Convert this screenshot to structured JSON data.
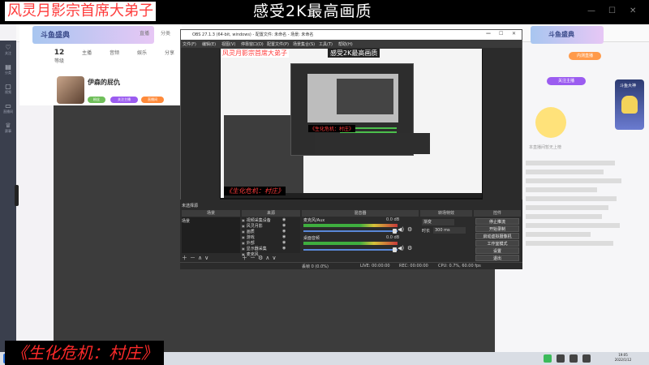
{
  "overlay": {
    "stream_title": "风灵月影宗首席大弟子",
    "quality_text": "感受2K最高画质",
    "subtitle": "《生化危机：村庄》"
  },
  "browser": {
    "left_banner": "斗鱼盛典",
    "nav_links": [
      "直播",
      "分类",
      "视频"
    ],
    "stats": [
      {
        "value": "12",
        "label": "等级"
      },
      {
        "value": "",
        "label": "主播"
      },
      {
        "value": "",
        "label": "音频"
      },
      {
        "value": "",
        "label": "娱乐"
      },
      {
        "value": "",
        "label": "分享"
      }
    ],
    "streamer_name": "伊森的屁仇",
    "pills": [
      "粉丝",
      "关注主播",
      "直播间"
    ],
    "right_banner": "斗鱼盛典",
    "current_button": "内测直播",
    "right_tag": "关注主播",
    "badge_label": "斗鱼大神",
    "mascot_caption": "本直播间暂无上榜"
  },
  "sidebar": {
    "items": [
      {
        "icon": "heart-icon",
        "glyph": "♡",
        "label": "关注"
      },
      {
        "icon": "gift-icon",
        "glyph": "▤",
        "label": "分类"
      },
      {
        "icon": "video-icon",
        "glyph": "▢",
        "label": "视频"
      },
      {
        "icon": "tv-icon",
        "glyph": "▭",
        "label": "直播间"
      },
      {
        "icon": "trophy-icon",
        "glyph": "♕",
        "label": "赛事"
      }
    ]
  },
  "obs": {
    "title": "OBS 27.1.3 (64-bit, windows) - 配置文件: 未命名 - 场景: 未命名",
    "menu": [
      "文件(F)",
      "编辑(E)",
      "视图(V)",
      "停靠窗口(D)",
      "配置文件(P)",
      "场景集合(S)",
      "工具(T)",
      "帮助(H)"
    ],
    "nested_red_title": "风灵月影宗首席大弟子",
    "nested_dark_title": "感受2K最高画质",
    "nested_subtitle": "《生化危机：村庄》",
    "docks": {
      "scenes_label": "场景",
      "sources_label": "来源",
      "mixer_label": "混音器",
      "transitions_label": "转场特效",
      "controls_label": "控件",
      "scene_list_label": "未选择源",
      "scene_item": "场景",
      "sources": [
        "视频采集设备",
        "风灵月影",
        "画质",
        "游戏",
        "外部",
        "显示器采集",
        "麦克风"
      ],
      "mixer": [
        {
          "name": "桌面音频",
          "db": "0.0 dB"
        },
        {
          "name": "麦克风/Aux",
          "db": "0.0 dB"
        }
      ],
      "transition_type": "渐变",
      "transition_duration_label": "时长",
      "transition_duration": "300 ms",
      "controls": [
        "停止推流",
        "开始录制",
        "启动虚拟摄像机",
        "工作室模式",
        "设置",
        "退出"
      ]
    },
    "status": {
      "dropped": "丢帧 0 (0.0%)",
      "live": "LIVE: 00:00:00",
      "rec": "REC: 00:00:00",
      "cpu": "CPU: 0.7%, 60.00 fps"
    }
  },
  "taskbar": {
    "time": "19:05",
    "date": "2022/1/12"
  }
}
